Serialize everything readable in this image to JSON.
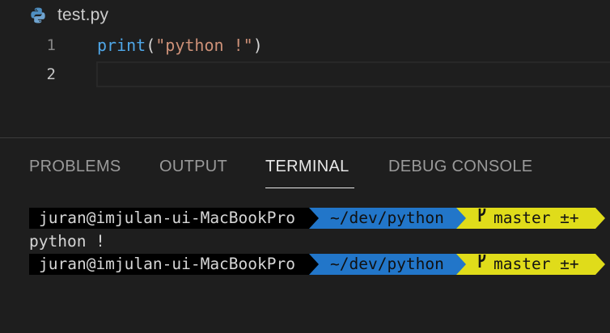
{
  "editor": {
    "file_name": "test.py",
    "file_icon": "python-icon",
    "lines": [
      {
        "number": "1",
        "fn": "print",
        "open": "(",
        "str": "\"python !\"",
        "close": ")"
      },
      {
        "number": "2",
        "text": ""
      }
    ]
  },
  "panel": {
    "tabs": [
      {
        "label": "PROBLEMS",
        "active": false
      },
      {
        "label": "OUTPUT",
        "active": false
      },
      {
        "label": "TERMINAL",
        "active": true
      },
      {
        "label": "DEBUG CONSOLE",
        "active": false
      }
    ]
  },
  "terminal": {
    "prompt1": {
      "user": "juran@imjulan-ui-MacBookPro",
      "path": "~/dev/python",
      "git": "master ±+",
      "git_icon": "git-branch-icon"
    },
    "output": "python !",
    "prompt2": {
      "user": "juran@imjulan-ui-MacBookPro",
      "path": "~/dev/python",
      "git": "master ±+",
      "git_icon": "git-branch-icon"
    }
  },
  "colors": {
    "background": "#1e1e1e",
    "prompt_user_bg": "#000000",
    "prompt_path_bg": "#2276c9",
    "prompt_git_bg": "#e0dc1a",
    "string": "#ce9178",
    "function": "#4fa7e8"
  }
}
